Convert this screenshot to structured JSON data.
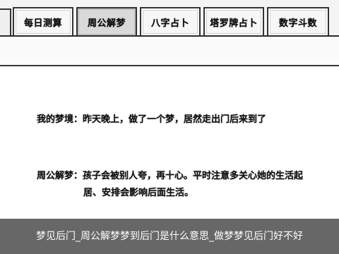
{
  "tabs": [
    {
      "label": "每日测算",
      "active": false
    },
    {
      "label": "周公解梦",
      "active": true
    },
    {
      "label": "八字占卜",
      "active": false
    },
    {
      "label": "塔罗牌占卜",
      "active": false
    },
    {
      "label": "数字斗数",
      "active": false
    }
  ],
  "content": {
    "p1": {
      "label": "我的梦境：",
      "text": "昨天晚上，做了一个梦，居然走出门后来到了"
    },
    "p2": {
      "label": "周公解梦：",
      "line1": "孩子会被别人夸，再十心。平时注意多关心她的生活起",
      "line2": "居、安排会影响后面生活。"
    }
  },
  "caption": "梦见后门_周公解梦梦到后门是什么意思_做梦梦见后门好不好",
  "colors": {
    "caption_bg": "#3c3c3c",
    "tab_active": "#d9d9d9",
    "border": "#333333"
  }
}
